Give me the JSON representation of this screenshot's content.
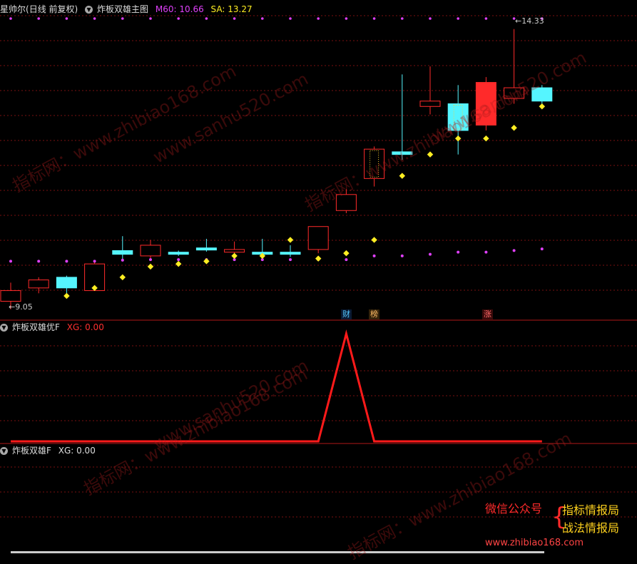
{
  "main_panel": {
    "stock_name": "星帅尔",
    "period": "(日线 前复权)",
    "indicator": "炸板双雄主图",
    "m60_label": "M60: 10.66",
    "sa_label": "SA: 13.27",
    "low_label": "9.05",
    "high_label": "14.33",
    "tags": [
      "财",
      "榜",
      "涨"
    ]
  },
  "sub_panel1": {
    "indicator": "炸板双雄优F",
    "xg_label": "XG: 0.00"
  },
  "sub_panel2": {
    "indicator": "炸板双雄F",
    "xg_label": "XG: 0.00"
  },
  "watermarks": [
    "指标网：www.zhibiao168.com",
    "www.sanhu520.com"
  ],
  "promo": {
    "label": "微信公众号",
    "line1": "指标情报局",
    "line2": "战法情报局",
    "url": "www.zhibiao168.com"
  },
  "colors": {
    "up": "#ff2a2a",
    "down": "#55f5ff",
    "magenta": "#e040fb",
    "yellow": "#ffee22",
    "grid": "#7a1010",
    "line": "#ff1a1a"
  },
  "chart_data": {
    "type": "candlestick",
    "x": [
      1,
      2,
      3,
      4,
      5,
      6,
      7,
      8,
      9,
      10,
      11,
      12,
      13,
      14,
      15,
      16,
      17,
      18,
      19,
      20
    ],
    "candles": [
      {
        "o": 9.2,
        "h": 9.55,
        "l": 9.05,
        "c": 9.4
      },
      {
        "o": 9.45,
        "h": 9.65,
        "l": 9.35,
        "c": 9.6
      },
      {
        "o": 9.65,
        "h": 9.68,
        "l": 9.35,
        "c": 9.45
      },
      {
        "o": 9.4,
        "h": 9.95,
        "l": 9.4,
        "c": 9.9
      },
      {
        "o": 10.15,
        "h": 10.42,
        "l": 9.97,
        "c": 10.08
      },
      {
        "o": 10.05,
        "h": 10.35,
        "l": 9.98,
        "c": 10.25
      },
      {
        "o": 10.12,
        "h": 10.15,
        "l": 10.05,
        "c": 10.1
      },
      {
        "o": 10.2,
        "h": 10.37,
        "l": 10.13,
        "c": 10.17
      },
      {
        "o": 10.12,
        "h": 10.32,
        "l": 10.07,
        "c": 10.17
      },
      {
        "o": 10.12,
        "h": 10.37,
        "l": 10.02,
        "c": 10.1
      },
      {
        "o": 10.12,
        "h": 10.25,
        "l": 10.03,
        "c": 10.1
      },
      {
        "o": 10.17,
        "h": 10.6,
        "l": 10.1,
        "c": 10.6
      },
      {
        "o": 10.9,
        "h": 11.3,
        "l": 10.85,
        "c": 11.2
      },
      {
        "o": 11.5,
        "h": 12.1,
        "l": 11.35,
        "c": 12.05
      },
      {
        "o": 12.0,
        "h": 13.45,
        "l": 11.85,
        "c": 11.95
      },
      {
        "o": 12.85,
        "h": 13.6,
        "l": 12.7,
        "c": 12.95
      },
      {
        "o": 12.9,
        "h": 13.25,
        "l": 11.95,
        "c": 12.4
      },
      {
        "o": 12.5,
        "h": 13.4,
        "l": 12.4,
        "c": 13.3
      },
      {
        "o": 13.0,
        "h": 14.3,
        "l": 12.9,
        "c": 13.2
      },
      {
        "o": 13.2,
        "h": 13.25,
        "l": 12.85,
        "c": 12.95
      }
    ],
    "m60": [
      9.95,
      9.95,
      9.95,
      9.95,
      9.97,
      9.98,
      9.98,
      9.98,
      9.98,
      9.98,
      9.98,
      9.98,
      9.98,
      10.05,
      10.05,
      10.08,
      10.12,
      10.12,
      10.15,
      10.18
    ],
    "sa": [
      null,
      null,
      9.3,
      9.45,
      9.65,
      9.85,
      9.9,
      9.95,
      10.05,
      10.05,
      10.35,
      10.0,
      10.1,
      10.35,
      11.55,
      11.95,
      12.25,
      12.25,
      12.45,
      12.85
    ],
    "ylim": [
      8.9,
      14.55
    ],
    "xg_signal": [
      0,
      0,
      0,
      0,
      0,
      0,
      0,
      0,
      0,
      0,
      0,
      0,
      1,
      0,
      0,
      0,
      0,
      0,
      0,
      0
    ]
  }
}
